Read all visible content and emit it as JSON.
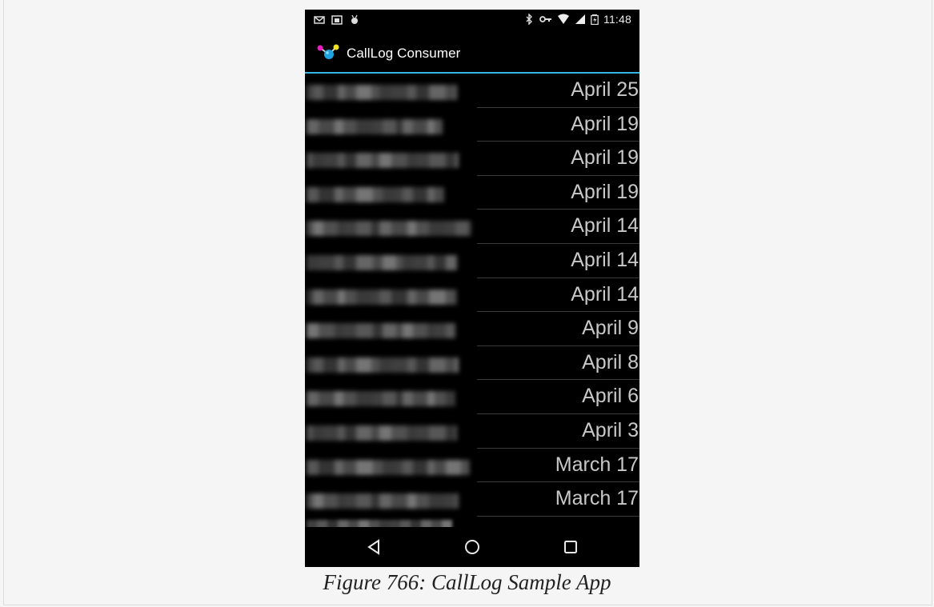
{
  "status_bar": {
    "time": "11:48",
    "left_icons": [
      "email-icon",
      "gallery-icon",
      "android-debug-icon"
    ],
    "right_icons": [
      "bluetooth-icon",
      "vpn-key-icon",
      "wifi-icon",
      "signal-icon",
      "battery-charging-icon"
    ]
  },
  "action_bar": {
    "title": "CallLog Consumer",
    "icon": "app-molecule-icon",
    "accent_color": "#33b5e5"
  },
  "call_log": {
    "entries": [
      {
        "date": "April 25"
      },
      {
        "date": "April 19"
      },
      {
        "date": "April 19"
      },
      {
        "date": "April 19"
      },
      {
        "date": "April 14"
      },
      {
        "date": "April 14"
      },
      {
        "date": "April 14"
      },
      {
        "date": "April 9"
      },
      {
        "date": "April 8"
      },
      {
        "date": "April 6"
      },
      {
        "date": "April 3"
      },
      {
        "date": "March 17"
      },
      {
        "date": "March 17"
      }
    ]
  },
  "nav_bar": {
    "buttons": [
      "back-icon",
      "home-icon",
      "recents-icon"
    ]
  },
  "caption": {
    "text": "Figure 766: CallLog Sample App"
  }
}
